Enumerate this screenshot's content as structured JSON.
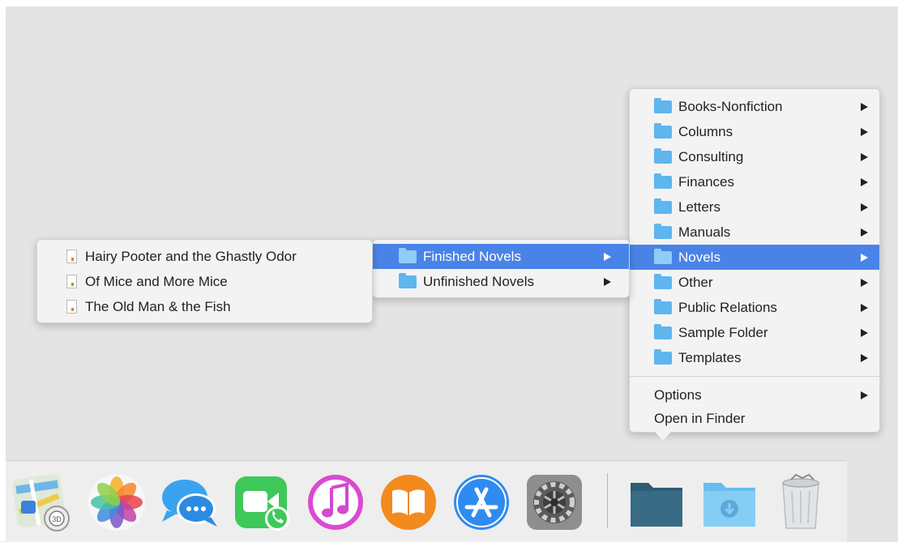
{
  "main_menu": {
    "items": [
      {
        "label": "Books-Nonfiction",
        "submenu": true,
        "selected": false
      },
      {
        "label": "Columns",
        "submenu": true,
        "selected": false
      },
      {
        "label": "Consulting",
        "submenu": true,
        "selected": false
      },
      {
        "label": "Finances",
        "submenu": true,
        "selected": false
      },
      {
        "label": "Letters",
        "submenu": true,
        "selected": false
      },
      {
        "label": "Manuals",
        "submenu": true,
        "selected": false
      },
      {
        "label": "Novels",
        "submenu": true,
        "selected": true
      },
      {
        "label": "Other",
        "submenu": true,
        "selected": false
      },
      {
        "label": "Public Relations",
        "submenu": true,
        "selected": false
      },
      {
        "label": "Sample Folder",
        "submenu": true,
        "selected": false
      },
      {
        "label": "Templates",
        "submenu": true,
        "selected": false
      }
    ],
    "options_label": "Options",
    "open_in_finder_label": "Open in Finder"
  },
  "novels_submenu": {
    "items": [
      {
        "label": "Finished Novels",
        "selected": true
      },
      {
        "label": "Unfinished Novels",
        "selected": false
      }
    ]
  },
  "finished_novels_submenu": {
    "items": [
      {
        "label": "Hairy Pooter and the Ghastly Odor"
      },
      {
        "label": "Of Mice and More Mice"
      },
      {
        "label": "The Old Man & the Fish"
      }
    ]
  },
  "dock": {
    "icons": [
      "maps-icon",
      "photos-icon",
      "messages-icon",
      "facetime-icon",
      "itunes-icon",
      "ibooks-icon",
      "app-store-icon",
      "system-preferences-icon",
      "documents-folder-icon",
      "downloads-folder-icon",
      "trash-icon"
    ]
  },
  "colors": {
    "selection": "#4a83e8",
    "folder": "#5fb5ee",
    "desktop": "#e4e4e4"
  }
}
